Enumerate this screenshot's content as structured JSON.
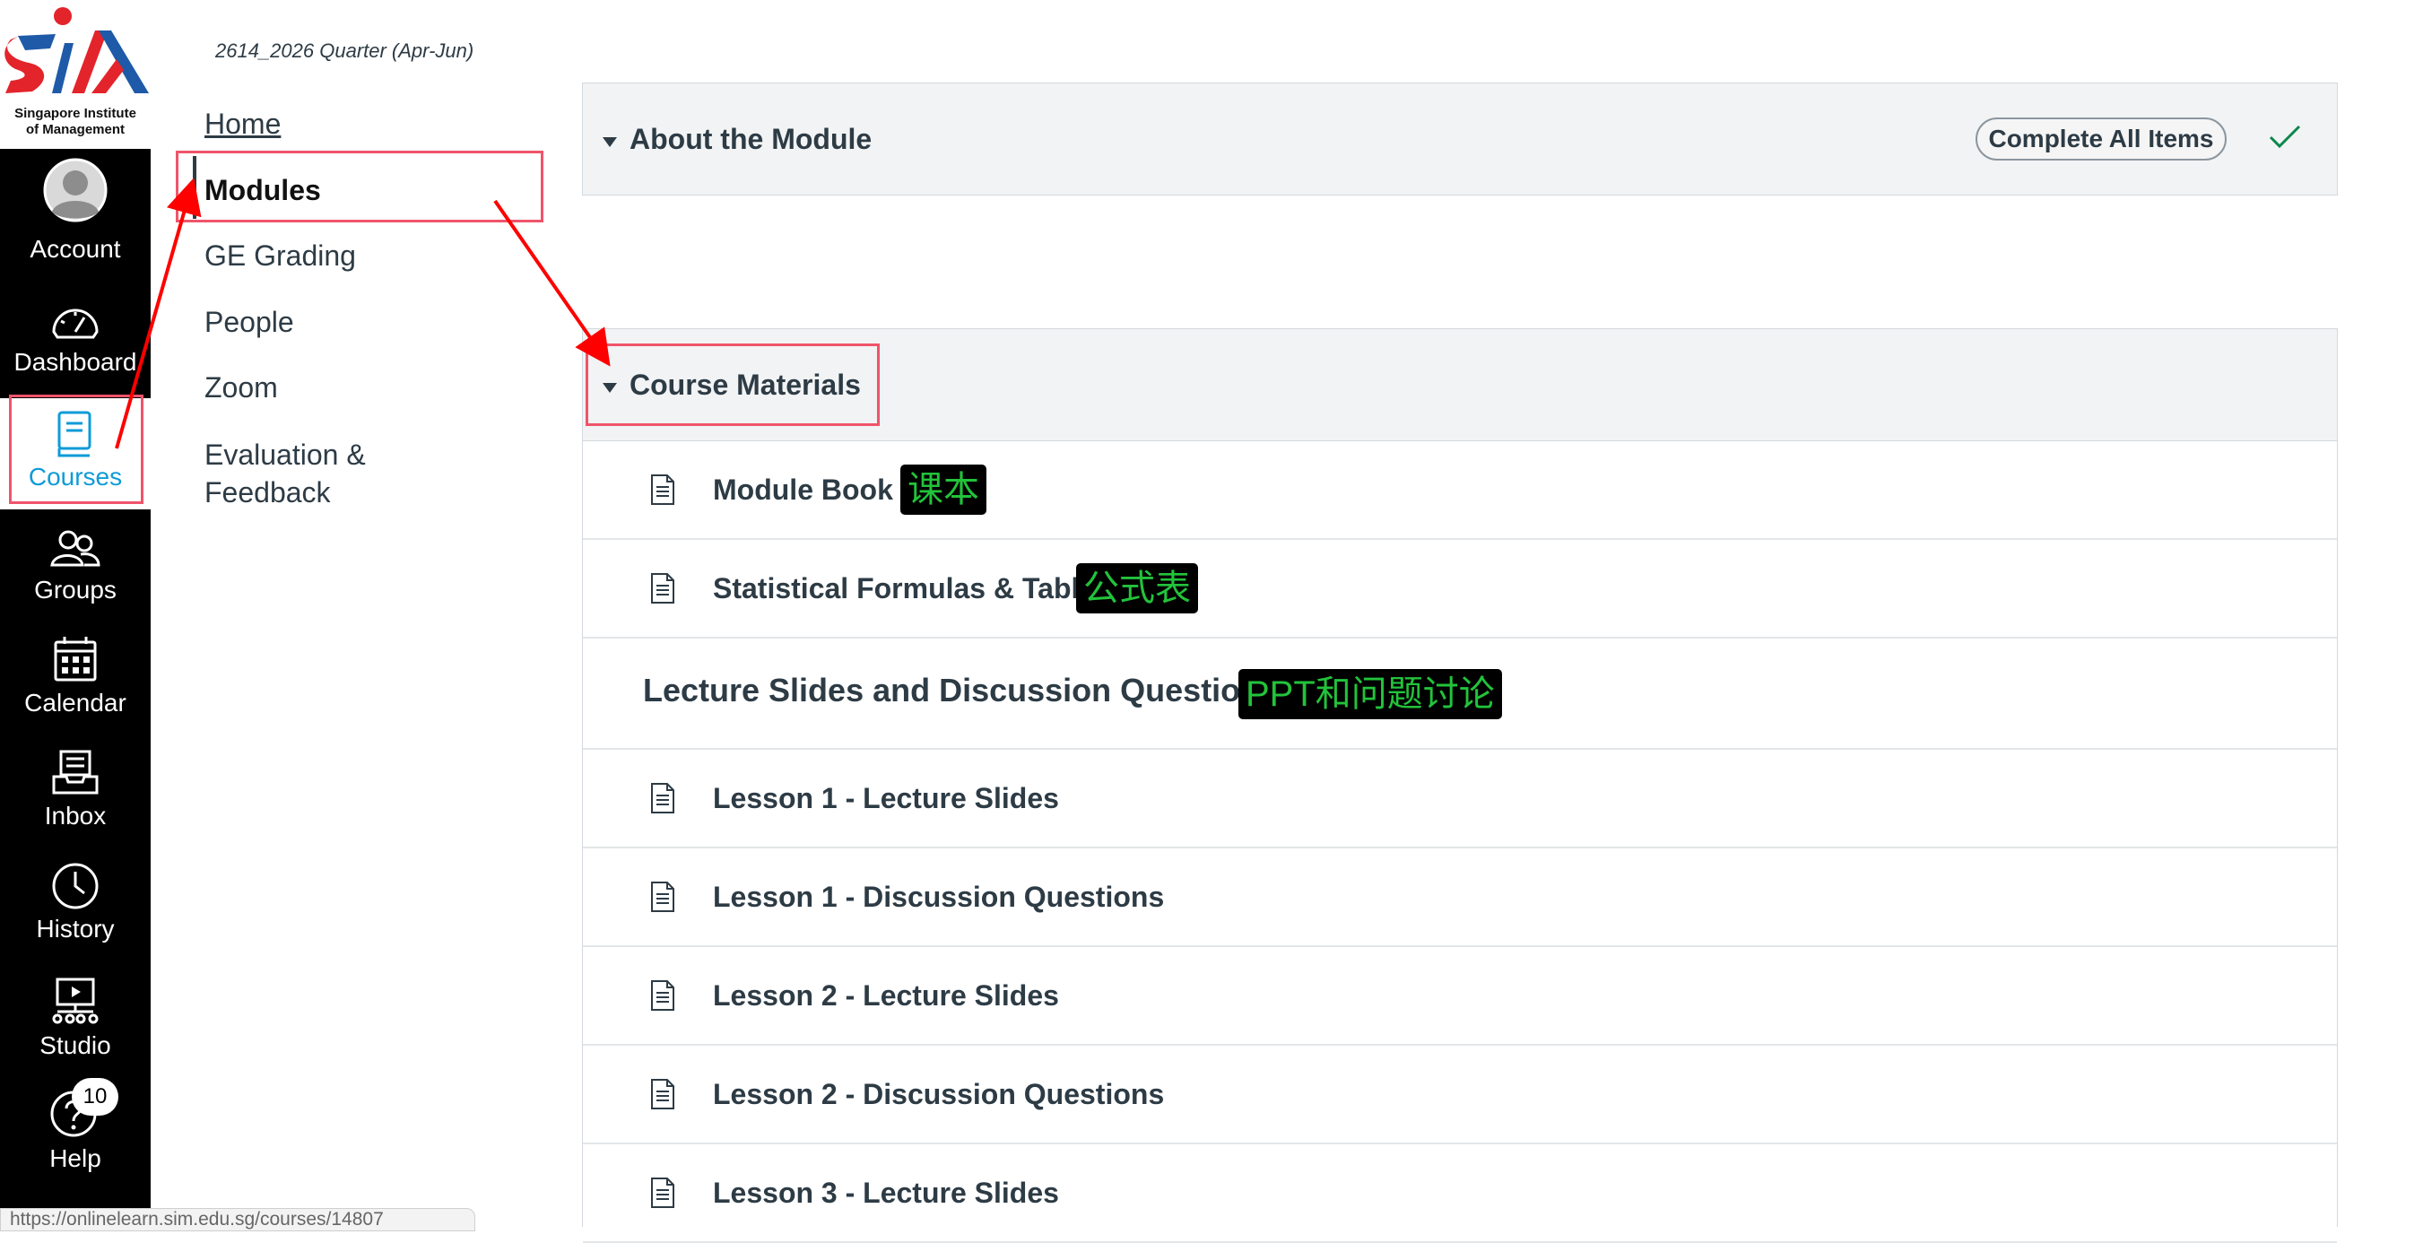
{
  "logo": {
    "line1": "Singapore Institute",
    "line2": "of Management"
  },
  "global_nav": {
    "items": [
      {
        "label": "Account",
        "icon": "user-avatar-icon"
      },
      {
        "label": "Dashboard",
        "icon": "speedometer-icon"
      },
      {
        "label": "Courses",
        "icon": "book-icon"
      },
      {
        "label": "Groups",
        "icon": "groups-icon"
      },
      {
        "label": "Calendar",
        "icon": "calendar-icon"
      },
      {
        "label": "Inbox",
        "icon": "inbox-icon"
      },
      {
        "label": "History",
        "icon": "clock-icon"
      },
      {
        "label": "Studio",
        "icon": "studio-icon"
      },
      {
        "label": "Help",
        "icon": "help-icon"
      }
    ],
    "help_badge": "10"
  },
  "course_nav": {
    "term": "2614_2026 Quarter (Apr-Jun)",
    "items": [
      {
        "label": "Home"
      },
      {
        "label": "Modules"
      },
      {
        "label": "GE Grading"
      },
      {
        "label": "People"
      },
      {
        "label": "Zoom"
      },
      {
        "label": "Evaluation & Feedback"
      }
    ]
  },
  "modules": [
    {
      "title": "About the Module",
      "complete_label": "Complete All Items"
    },
    {
      "title": "Course Materials",
      "items": [
        {
          "title": "Module Book",
          "type": "page",
          "annotation": "课本"
        },
        {
          "title": "Statistical Formulas & Tables",
          "type": "page",
          "annotation": "公式表"
        },
        {
          "title": "Lecture Slides and Discussion Questions",
          "type": "subheader",
          "annotation": "PPT和问题讨论"
        },
        {
          "title": "Lesson 1 - Lecture Slides",
          "type": "page"
        },
        {
          "title": "Lesson 1 - Discussion Questions",
          "type": "page"
        },
        {
          "title": "Lesson 2 - Lecture Slides",
          "type": "page"
        },
        {
          "title": "Lesson 2 - Discussion Questions",
          "type": "page"
        },
        {
          "title": "Lesson 3 - Lecture Slides",
          "type": "page"
        }
      ]
    }
  ],
  "status_bar": {
    "url": "https://onlinelearn.sim.edu.sg/courses/14807"
  },
  "colors": {
    "nav_bg": "#000000",
    "active_blue": "#0e9bd8",
    "highlight_red": "#f0546b",
    "arrow_red": "#ff0000",
    "annotation_green": "#22c33a",
    "check_green": "#0b874b",
    "logo_red": "#e3242b",
    "logo_blue": "#1e5aa8"
  }
}
